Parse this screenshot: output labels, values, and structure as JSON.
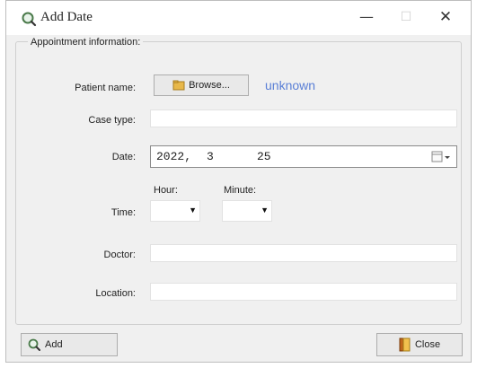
{
  "window": {
    "title": "Add Date",
    "controls": {
      "minimize": "—",
      "maximize": "☐",
      "close": "✕"
    }
  },
  "group": {
    "legend": "Appointment information:"
  },
  "patient": {
    "label": "Patient name:",
    "browse_label": "Browse...",
    "value": "unknown"
  },
  "case_type": {
    "label": "Case type:",
    "value": ""
  },
  "date": {
    "label": "Date:",
    "year": "2022,",
    "month": "3",
    "day": "25"
  },
  "time": {
    "label": "Time:",
    "hour_label": "Hour:",
    "minute_label": "Minute:",
    "hour_value": "",
    "minute_value": ""
  },
  "doctor": {
    "label": "Doctor:",
    "value": ""
  },
  "location": {
    "label": "Location:",
    "value": ""
  },
  "buttons": {
    "add": "Add",
    "close": "Close"
  }
}
